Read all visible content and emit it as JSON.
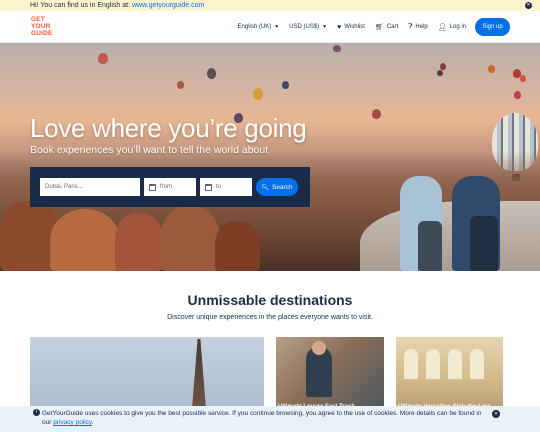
{
  "notice": {
    "text": "Hi! You can find us in English at:",
    "link": "www.getyourguide.com",
    "close_icon": "close-icon"
  },
  "header": {
    "logo_lines": [
      "GET",
      "YOUR",
      "GUIDE"
    ],
    "language": "English (UK)",
    "currency": "USD (US$)",
    "wishlist": "Wishlist",
    "cart": "Cart",
    "help": "Help",
    "login": "Log in",
    "signup": "Sign up"
  },
  "hero": {
    "title": "Love where you’re going",
    "subtitle": "Book experiences you’ll want to tell the world about",
    "search": {
      "destination_placeholder": "Dubai, Paris...",
      "from_placeholder": "from",
      "to_placeholder": "to",
      "button": "Search"
    }
  },
  "destinations": {
    "title": "Unmissable destinations",
    "subtitle": "Discover unique experiences in the places everyone wants to visit.",
    "cards": [
      {
        "label": ""
      },
      {
        "label": "Ultimate Louvre Fast Track"
      },
      {
        "label": "Ultimate Versailles Skip-the-Line"
      }
    ]
  },
  "cookie": {
    "text": "GetYourGuide uses cookies to give you the best possible service. If you continue browsing, you agree to the use of cookies. More details can be found in our",
    "link": "privacy policy",
    "end": "."
  },
  "colors": {
    "brand": "#ff5533",
    "primary": "#0071eb",
    "navy": "#1a2b49",
    "notice_bg": "#fff3cd",
    "cookie_bg": "#e9f1fa"
  }
}
